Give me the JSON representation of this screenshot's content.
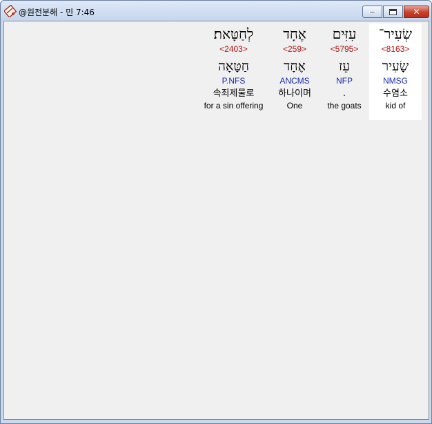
{
  "window": {
    "title": "@원전분해 - 민 7:46",
    "icon": "app-book-icon",
    "controls": {
      "minimize": "minimize-icon",
      "maximize": "maximize-icon",
      "close": "close-icon"
    }
  },
  "words": [
    {
      "hebrew": "שְׂעִיר־",
      "strong": "<8163>",
      "root": "שָׂעִיר",
      "parse": "NMSG",
      "korean": "수염소",
      "english": "kid of",
      "selected": true
    },
    {
      "hebrew": "עִזִּים",
      "strong": "<5795>",
      "root": "עֵז",
      "parse": "NFP",
      "korean": ".",
      "english": "the goats",
      "selected": false
    },
    {
      "hebrew": "אֶחָד",
      "strong": "<259>",
      "root": "אֶחָד",
      "parse": "ANCMS",
      "korean": "하나이며",
      "english": "One",
      "selected": false
    },
    {
      "hebrew": "לְחַטָּאת׃",
      "strong": "<2403>",
      "root": "חַטָּאָה",
      "parse": "P.NFS",
      "korean": "속죄제물로",
      "english": "for a sin offering",
      "selected": false
    }
  ],
  "colors": {
    "strong": "#b01010",
    "parse": "#1a2aa8",
    "background": "#f0f0f0",
    "selected": "#ffffff"
  }
}
